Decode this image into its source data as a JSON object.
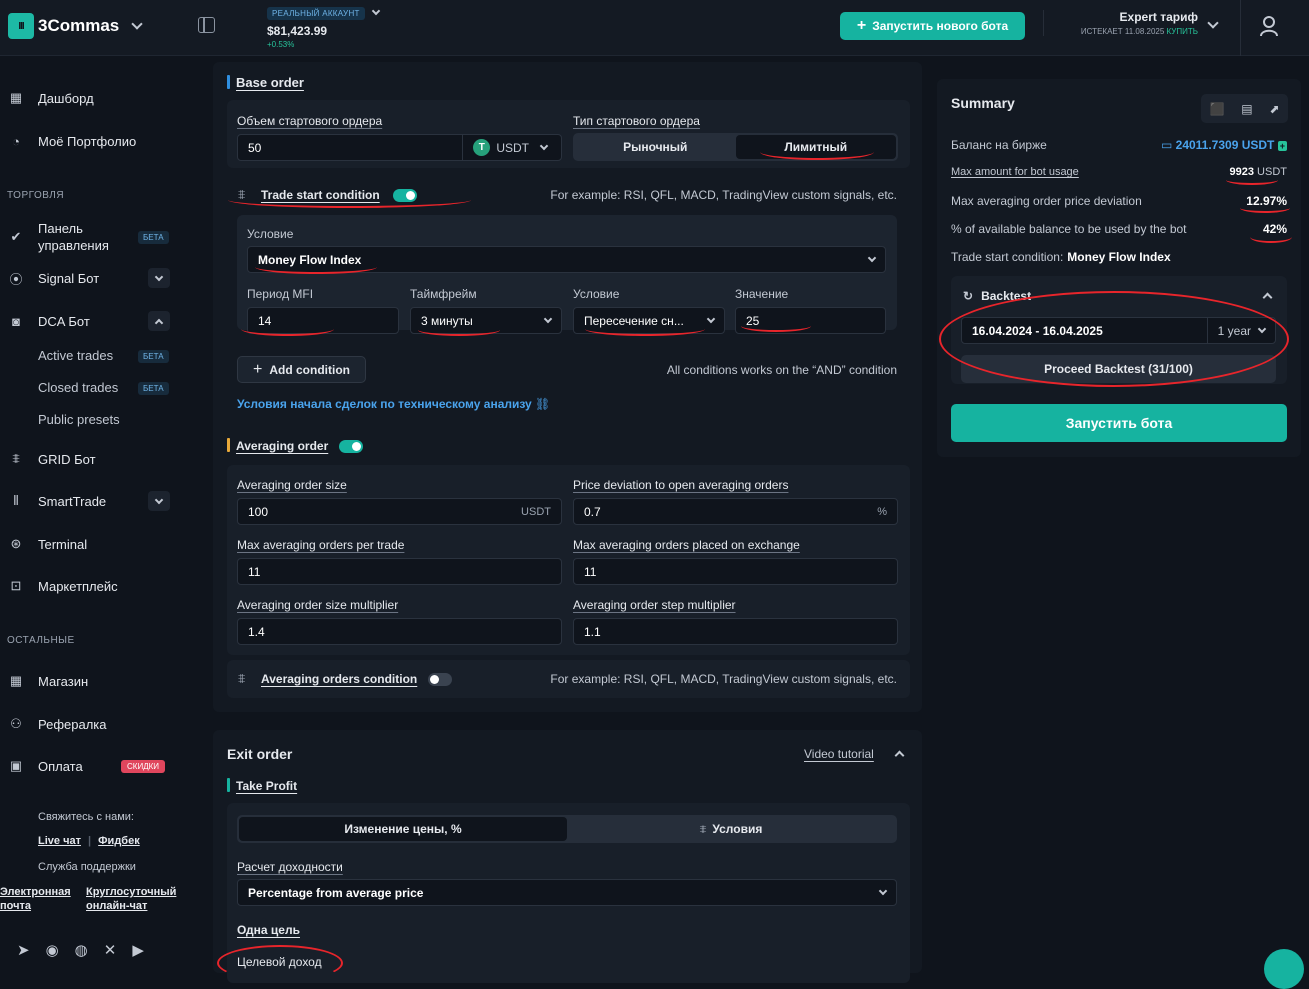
{
  "topbar": {
    "logo": "3Commas",
    "logo_mark": "III",
    "account_badge": "РЕАЛЬНЫЙ АККАУНТ",
    "balance": "$81,423.99",
    "change": "+0.53%",
    "launch_button": "Запустить нового бота",
    "tariff_title": "Expert тариф",
    "tariff_expires": "ИСТЕКАЕТ 11.08.2025",
    "tariff_buy": "КУПИТЬ"
  },
  "sidebar": {
    "dashboard": "Дашборд",
    "portfolio": "Моё Портфолио",
    "section_trading": "ТОРГОВЛЯ",
    "panel": "Панель управления",
    "panel_badge": "БЕТА",
    "signal_bot": "Signal Бот",
    "dca_bot": "DCA Бот",
    "active_trades": "Active trades",
    "active_badge": "БЕТА",
    "closed_trades": "Closed trades",
    "closed_badge": "БЕТА",
    "public_presets": "Public presets",
    "grid_bot": "GRID Бот",
    "smarttrade": "SmartTrade",
    "terminal": "Terminal",
    "marketplace": "Маркетплейс",
    "section_other": "ОСТАЛЬНЫЕ",
    "shop": "Магазин",
    "referral": "Рефералка",
    "payment": "Оплата",
    "payment_badge": "СКИДКИ",
    "contact": "Свяжитесь с нами:",
    "live_chat": "Live чат",
    "feedback": "Фидбек",
    "support": "Служба поддержки",
    "email": "Электронная почта",
    "chat247": "Круглосуточный онлайн-чат"
  },
  "base_order": {
    "title": "Base order",
    "volume_label": "Объем стартового ордера",
    "volume_value": "50",
    "currency": "USDT",
    "currency_icon": "T",
    "type_label": "Тип стартового ордера",
    "type_market": "Рыночный",
    "type_limit": "Лимитный"
  },
  "trade_start": {
    "title": "Trade start condition",
    "hint": "For example: RSI, QFL, MACD, TradingView custom signals, etc.",
    "condition_label": "Условие",
    "condition_value": "Money Flow Index",
    "period_label": "Период MFI",
    "period_value": "14",
    "timeframe_label": "Таймфрейм",
    "timeframe_value": "3 минуты",
    "cond2_label": "Условие",
    "cond2_value": "Пересечение сн...",
    "value_label": "Значение",
    "value_value": "25",
    "add_condition": "Add condition",
    "and_hint": "All conditions works on the “AND” condition",
    "ta_link": "Условия начала сделок по техническому анализу"
  },
  "averaging": {
    "title": "Averaging order",
    "size_label": "Averaging order size",
    "size_value": "100",
    "size_unit": "USDT",
    "deviation_label": "Price deviation to open averaging orders",
    "deviation_value": "0.7",
    "deviation_unit": "%",
    "max_per_trade_label": "Max averaging orders per trade",
    "max_per_trade_value": "11",
    "max_exchange_label": "Max averaging orders placed on exchange",
    "max_exchange_value": "11",
    "size_mult_label": "Averaging order size multiplier",
    "size_mult_value": "1.4",
    "step_mult_label": "Averaging order step multiplier",
    "step_mult_value": "1.1",
    "cond_title": "Averaging orders condition",
    "cond_hint": "For example: RSI, QFL, MACD, TradingView custom signals, etc."
  },
  "exit": {
    "title": "Exit order",
    "video": "Video tutorial",
    "tp_title": "Take Profit",
    "tab_price": "Изменение цены, %",
    "tab_cond": "Условия",
    "calc_label": "Расчет доходности",
    "calc_value": "Percentage from average price",
    "one_target": "Одна цель",
    "target_income": "Целевой доход"
  },
  "summary": {
    "title": "Summary",
    "balance_label": "Баланс на бирже",
    "balance_value": "24011.7309 USDT",
    "max_amount_label": "Max amount for bot usage",
    "max_amount_value": "9923",
    "max_amount_unit": "USDT",
    "max_dev_label": "Max averaging order price deviation",
    "max_dev_value": "12.97%",
    "pct_label": "% of available balance to be used by the bot",
    "pct_value": "42%",
    "tsc_label": "Trade start condition:",
    "tsc_value": "Money Flow Index",
    "backtest_title": "Backtest",
    "date_range": "16.04.2024 - 16.04.2025",
    "period": "1 year",
    "proceed": "Proceed Backtest (31/100)",
    "start_bot": "Запустить бота"
  }
}
